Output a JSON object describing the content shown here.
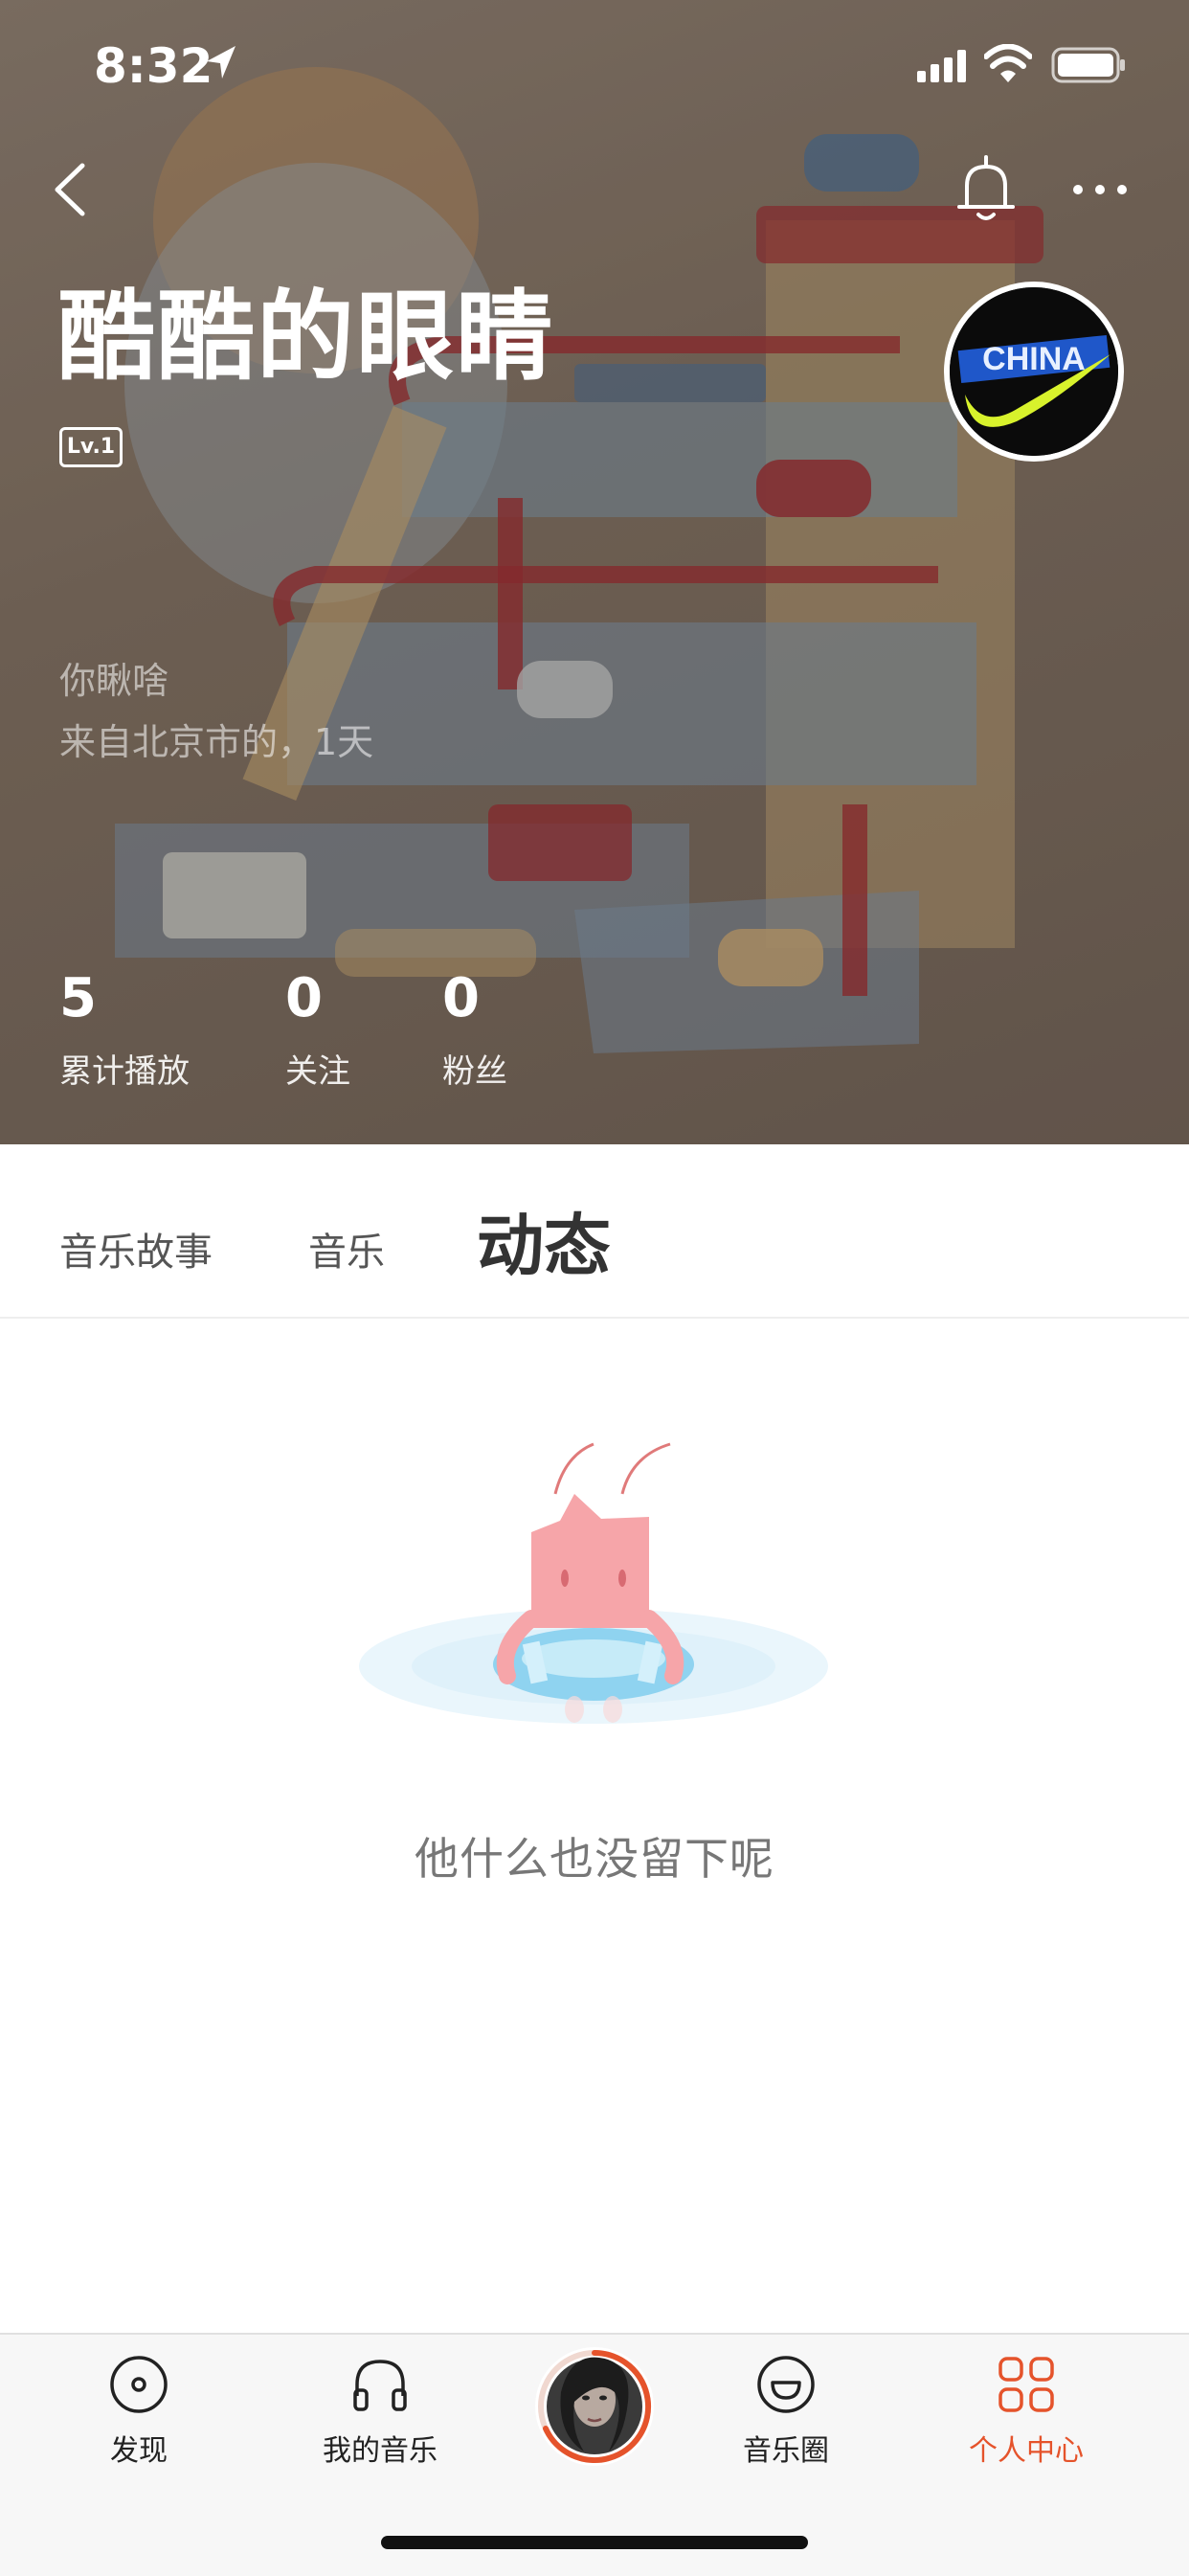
{
  "status_bar": {
    "time": "8:32",
    "icons": [
      "location-arrow-icon",
      "signal-icon",
      "wifi-icon",
      "battery-icon"
    ]
  },
  "header": {
    "back_icon": "chevron-left-icon",
    "bell_icon": "bell-icon",
    "more_icon": "ellipsis-icon",
    "name": "酷酷的眼睛",
    "level": "Lv.1",
    "bio": "你瞅啥",
    "location_line": "来自北京市的，1天",
    "stats": [
      {
        "value": "5",
        "label": "累计播放"
      },
      {
        "value": "0",
        "label": "关注"
      },
      {
        "value": "0",
        "label": "粉丝"
      }
    ],
    "avatar_text": "CHINA"
  },
  "tabs": {
    "items": [
      "音乐故事",
      "音乐",
      "动态"
    ],
    "active": "动态"
  },
  "empty_state": {
    "message": "他什么也没留下呢",
    "illustration": "shrimp-swim-ring-illustration"
  },
  "bottom_nav": {
    "items": [
      {
        "label": "发现",
        "icon": "disc-icon"
      },
      {
        "label": "我的音乐",
        "icon": "headphones-icon"
      },
      {
        "label": "音乐圈",
        "icon": "smile-icon"
      },
      {
        "label": "个人中心",
        "icon": "grid-icon"
      }
    ],
    "active": "个人中心",
    "active_color": "#e5532b",
    "player_icon": "now-playing-avatar"
  },
  "colors": {
    "accent": "#e5532b",
    "header_overlay": "#7c6b5c"
  }
}
